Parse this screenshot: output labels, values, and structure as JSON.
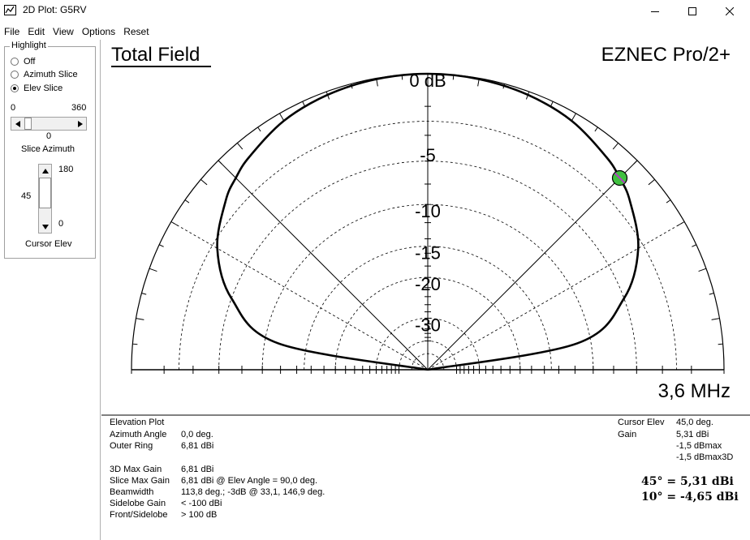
{
  "window": {
    "title": "2D Plot: G5RV"
  },
  "menu": [
    "File",
    "Edit",
    "View",
    "Options",
    "Reset"
  ],
  "highlight": {
    "legend": "Highlight",
    "options": [
      "Off",
      "Azimuth Slice",
      "Elev Slice"
    ],
    "selected": "Elev Slice"
  },
  "slice_azimuth": {
    "min": "0",
    "max": "360",
    "value": "0",
    "label": "Slice Azimuth"
  },
  "cursor_elev": {
    "max": "180",
    "min": "0",
    "value": "45",
    "label": "Cursor Elev"
  },
  "plot": {
    "title": "Total Field",
    "brand": "EZNEC Pro/2+",
    "frequency": "3,6 MHz",
    "ring_labels": [
      "0 dB",
      "-5",
      "-10",
      "-15",
      "-20",
      "-30"
    ],
    "curve_color": "#000000",
    "cursor_color": "#40c040"
  },
  "chart_data": {
    "type": "polar-elevation",
    "title": "Total Field",
    "rings_db": [
      0,
      -5,
      -10,
      -15,
      -20,
      -30
    ],
    "elevation_deg": [
      0,
      10,
      20,
      30,
      40,
      45,
      50,
      60,
      70,
      80,
      90,
      100,
      110,
      120,
      130,
      135,
      140,
      150,
      160,
      170,
      180
    ],
    "gain_rel_db": [
      -100,
      -11.5,
      -6.0,
      -3.4,
      -2.0,
      -1.5,
      -1.1,
      -0.5,
      -0.2,
      -0.05,
      0,
      -0.05,
      -0.2,
      -0.5,
      -1.1,
      -1.5,
      -2.0,
      -3.4,
      -6.0,
      -11.5,
      -100
    ],
    "cursor": {
      "elevation_deg": 45,
      "gain_dbi": 5.31
    }
  },
  "info_left": {
    "heading": "Elevation Plot",
    "rows": [
      [
        "Azimuth Angle",
        "0,0 deg."
      ],
      [
        "Outer Ring",
        "6,81 dBi"
      ]
    ],
    "rows2": [
      [
        "3D Max Gain",
        "6,81 dBi"
      ],
      [
        "Slice Max Gain",
        "6,81 dBi @ Elev Angle = 90,0 deg."
      ],
      [
        "Beamwidth",
        "113,8 deg.; -3dB @ 33,1, 146,9 deg."
      ],
      [
        "Sidelobe Gain",
        "< -100 dBi"
      ],
      [
        "Front/Sidelobe",
        "> 100 dB"
      ]
    ]
  },
  "info_right": {
    "cursor_elev_label": "Cursor Elev",
    "cursor_elev_value": "45,0 deg.",
    "gain_label": "Gain",
    "gain_value": "5,31 dBi",
    "dbmax": "-1,5 dBmax",
    "dbmax3d": "-1,5 dBmax3D"
  },
  "annotations": [
    "45° = 5,31 dBi",
    "10° = -4,65 dBi"
  ]
}
